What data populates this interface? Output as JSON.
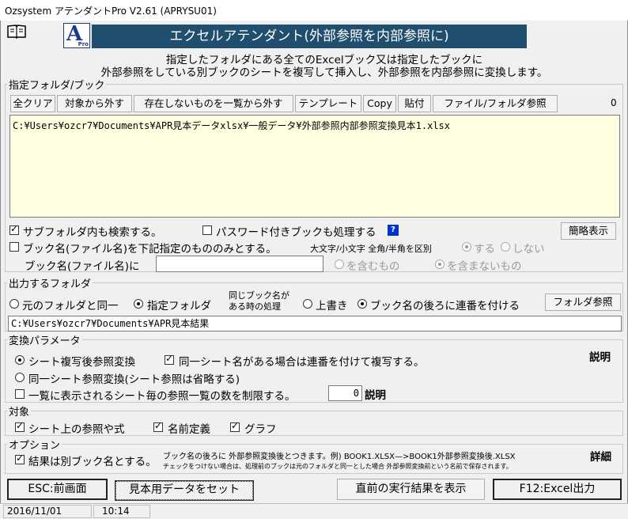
{
  "window": {
    "title": "Ozsystem アテンダントPro V2.61 (APRYSU01)"
  },
  "banner": {
    "logo_letter": "A",
    "logo_sub": "Pro",
    "title": "エクセルアテンダント(外部参照を内部参照に)"
  },
  "intro": {
    "line1": "指定したフォルダにある全てのExcelブック又は指定したブックに",
    "line2": "外部参照をしている別ブックのシートを複写して挿入し、外部参照を内部参照に変換します。"
  },
  "folder_section": {
    "title": "指定フォルダ/ブック",
    "buttons": {
      "clear_all": "全クリア",
      "remove": "対象から外す",
      "remove_missing": "存在しないものを一覧から外す",
      "template": "テンプレート",
      "copy": "Copy",
      "paste": "貼付",
      "browse": "ファイル/フォルダ参照"
    },
    "count": "0",
    "path_list": "C:¥Users¥ozcr7¥Documents¥APR見本データxlsx¥一般データ¥外部参照内部参照変換見本1.xlsx",
    "search_subfolders": "サブフォルダ内も検索する。",
    "process_password_books": "パスワード付きブックも処理する",
    "help_label": "?",
    "simple_view": "簡略表示",
    "bookname_only": "ブック名(ファイル名)を下記指定のもののみとする。",
    "case_width_label": "大文字/小文字 全角/半角を区別",
    "yes": "する",
    "no": "しない",
    "bookname_label": "ブック名(ファイル名)に",
    "bookname_value": "",
    "contains": "を含むもの",
    "not_contains": "を含まないもの"
  },
  "output_section": {
    "title": "出力するフォルダ",
    "same_folder": "元のフォルダと同一",
    "specified_folder": "指定フォルダ",
    "same_name_line1": "同じブック名が",
    "same_name_line2": "ある時の処理",
    "overwrite": "上書き",
    "append_number": "ブック名の後ろに連番を付ける",
    "browse_folder": "フォルダ参照",
    "output_path": "C:¥Users¥ozcr7¥Documents¥APR見本結果"
  },
  "params_section": {
    "title": "変換パラメータ",
    "convert_after_copy": "シート複写後参照変換",
    "number_duplicates": "同一シート名がある場合は連番を付けて複写する。",
    "explain": "説明",
    "same_sheet_ref": "同一シート参照変換(シート参照は省略する)",
    "limit_refs": "一覧に表示されるシート毎の参照一覧の数を制限する。",
    "limit_value": "0",
    "explain2": "説明"
  },
  "target_section": {
    "title": "対象",
    "refs_on_sheet": "シート上の参照や式",
    "name_defs": "名前定義",
    "graphs": "グラフ"
  },
  "options_section": {
    "title": "オプション",
    "save_as_other": "結果は別ブック名とする。",
    "note1": "ブック名の後ろに 外部参照変換後とつきます。例) BOOK1.XLSX—>BOOK1外部参照変換後.XLSX",
    "note2": "チェックをつけない場合は、処理前のブックは元のフォルダと同一とした場合 外部参照変換前という名前で保存されます。",
    "details": "詳細"
  },
  "footer": {
    "esc": "ESC:前画面",
    "sample_data": "見本用データをセット",
    "show_last": "直前の実行結果を表示",
    "f12": "F12:Excel出力"
  },
  "status": {
    "date": "2016/11/01",
    "time": "10:14"
  }
}
